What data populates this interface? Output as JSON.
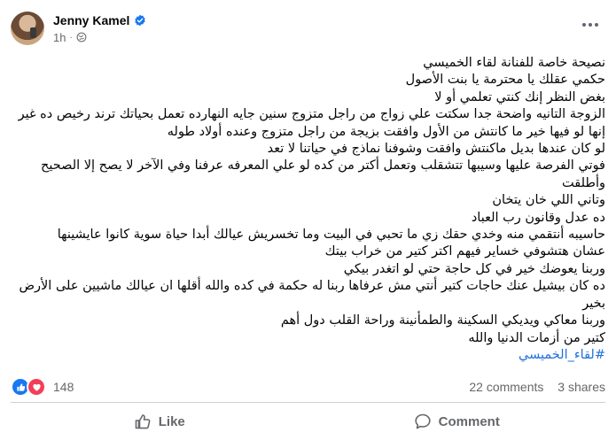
{
  "post": {
    "author": "Jenny Kamel",
    "time": "1h",
    "lines": [
      "نصيحة خاصة للفنانة لقاء الخميسي",
      "حكمي عقلك يا محترمة يا بنت الأصول",
      "بغض النظر إنك كنتي تعلمي أو لا",
      "الزوجة التانيه واضحة جدا سكتت علي زواج من راجل متزوج سنين جايه النهارده تعمل بحياتك ترند رخيص ده غير",
      "إنها لو فيها خير ما كانتش من الأول وافقت بزيجة من راجل متزوج وعنده أولاد طوله",
      "لو كان عندها بديل ماكنتش وافقت وشوفنا نماذج في حياتنا لا تعد",
      "فوتي الفرصة عليها وسيبها تتشقلب وتعمل أكتر من كده لو علي المعرفه عرفنا وفي الآخر لا يصح إلا الصحيح",
      "وأطلقت",
      "وتاني اللي خان يتخان",
      "ده عدل وقانون رب العباد",
      "حاسيبه أنتقمي  منه وخدي حقك زي ما تحبي في البيت وما تخسريش عيالك أبدا حياة سوية كانوا عايشينها",
      "عشان هتشوفي خساير فيهم اكتر كتير من خراب بيتك",
      "وربنا يعوضك خير في كل حاجة حتي لو اتغدر بيكي",
      "ده كان بيشيل عنك حاجات كتير أنتي مش عرفاها ربنا له حكمة في كده والله أقلها ان عيالك ماشيين على الأرض",
      "بخير",
      "وربنا معاكي ويديكي السكينة والطمأنينة وراحة القلب دول أهم",
      "كتير من أزمات الدنيا والله"
    ],
    "hashtag": "#لقاء_الخميسي"
  },
  "stats": {
    "reactions_count": "148",
    "comments": "22 comments",
    "shares": "3 shares"
  },
  "actions": {
    "like": "Like",
    "comment": "Comment"
  },
  "colors": {
    "accent": "#1877f2",
    "love": "#f33e58",
    "hashtag": "#216fdb",
    "muted": "#65676b"
  },
  "icons": [
    "verified-badge-icon",
    "globe-icon",
    "more-options-icon",
    "like-reaction-icon",
    "love-reaction-icon",
    "thumbs-up-icon",
    "comment-bubble-icon"
  ]
}
